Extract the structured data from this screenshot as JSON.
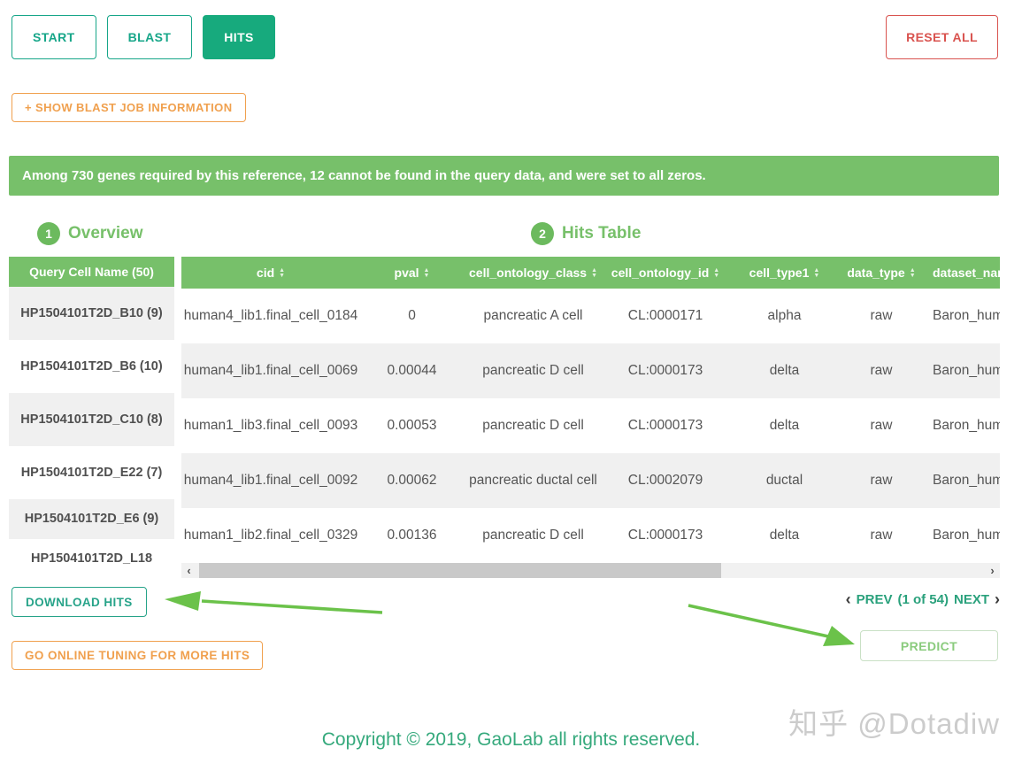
{
  "nav": {
    "tabs": [
      {
        "label": "START",
        "active": false
      },
      {
        "label": "BLAST",
        "active": false
      },
      {
        "label": "HITS",
        "active": true
      }
    ],
    "reset_all_label": "RESET ALL"
  },
  "job_info": {
    "label": "+ SHOW BLAST JOB INFORMATION"
  },
  "alert": {
    "text": "Among 730 genes required by this reference, 12 cannot be found in the query data, and were set to all zeros."
  },
  "sections": {
    "overview": {
      "number": "1",
      "title": "Overview"
    },
    "hits": {
      "number": "2",
      "title": "Hits Table"
    }
  },
  "overview_table": {
    "header": "Query Cell Name (50)",
    "rows": [
      "HP1504101T2D_B10 (9)",
      "HP1504101T2D_B6 (10)",
      "HP1504101T2D_C10 (8)",
      "HP1504101T2D_E22 (7)",
      "HP1504101T2D_E6 (9)",
      "HP1504101T2D_L18"
    ]
  },
  "hits_table": {
    "columns": [
      "cid",
      "pval",
      "cell_ontology_class",
      "cell_ontology_id",
      "cell_type1",
      "data_type",
      "dataset_name"
    ],
    "rows": [
      [
        "human4_lib1.final_cell_0184",
        "0",
        "pancreatic A cell",
        "CL:0000171",
        "alpha",
        "raw",
        "Baron_human"
      ],
      [
        "human4_lib1.final_cell_0069",
        "0.00044",
        "pancreatic D cell",
        "CL:0000173",
        "delta",
        "raw",
        "Baron_human"
      ],
      [
        "human1_lib3.final_cell_0093",
        "0.00053",
        "pancreatic D cell",
        "CL:0000173",
        "delta",
        "raw",
        "Baron_human"
      ],
      [
        "human4_lib1.final_cell_0092",
        "0.00062",
        "pancreatic ductal cell",
        "CL:0002079",
        "ductal",
        "raw",
        "Baron_human"
      ],
      [
        "human1_lib2.final_cell_0329",
        "0.00136",
        "pancreatic D cell",
        "CL:0000173",
        "delta",
        "raw",
        "Baron_human"
      ]
    ]
  },
  "actions": {
    "download_label": "DOWNLOAD HITS",
    "tuning_label": "GO ONLINE TUNING FOR MORE HITS",
    "predict_label": "PREDICT"
  },
  "pagination": {
    "prev_chevron": "‹",
    "prev_label": "PREV",
    "status": "(1 of 54)",
    "next_label": "NEXT",
    "next_chevron": "›"
  },
  "footer": {
    "copyright": "Copyright © 2019, GaoLab all rights reserved.",
    "watermark": "知乎 @Dotadiw"
  },
  "icons": {
    "sort_asc": "▲",
    "sort_desc": "▼",
    "scroll_left": "‹",
    "scroll_right": "›"
  },
  "colors": {
    "accent_teal": "#17a689",
    "active_tab_green": "#17aa7d",
    "success_green": "#77c06a",
    "circle_green": "#6cba5e",
    "orange": "#f0a04e",
    "red": "#d9534f",
    "arrow_green": "#6bc24a",
    "predict_green": "#8acb7d",
    "alt_row_gray": "#f0f0f0"
  }
}
